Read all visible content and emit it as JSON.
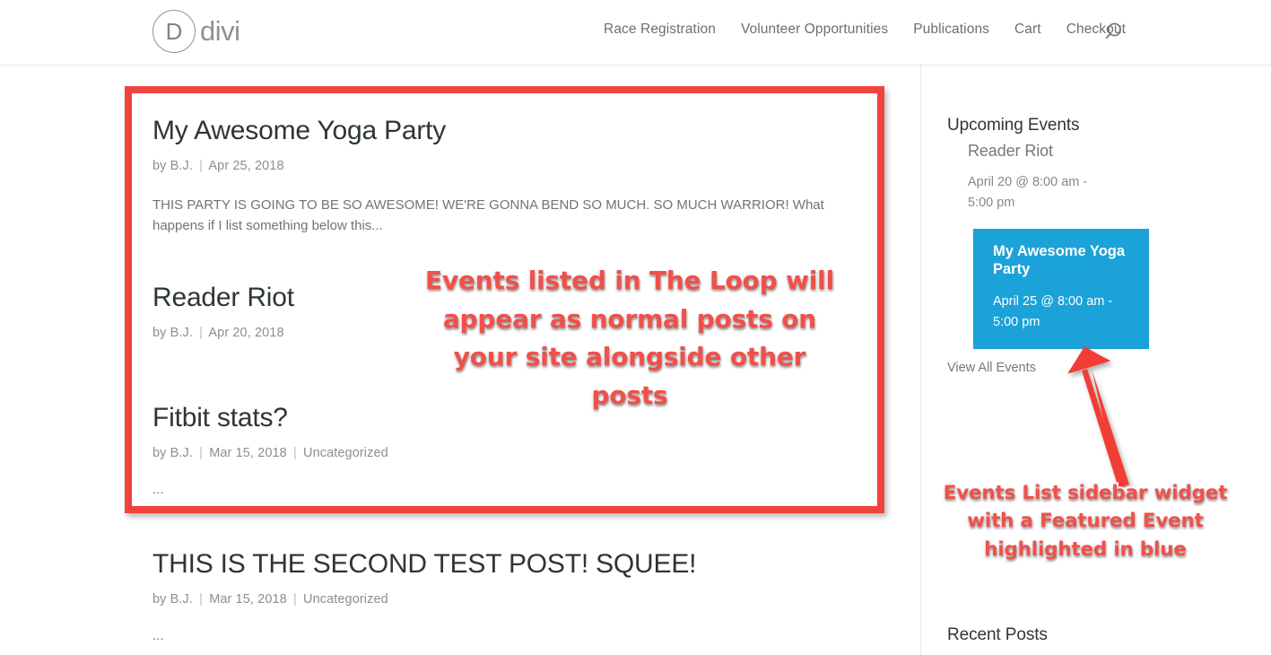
{
  "header": {
    "logo_letter": "D",
    "logo_text": "divi",
    "nav": [
      {
        "label": "Race Registration"
      },
      {
        "label": "Volunteer Opportunities"
      },
      {
        "label": "Publications"
      },
      {
        "label": "Cart"
      },
      {
        "label": "Checkout"
      }
    ],
    "search_icon": "search-icon"
  },
  "posts": [
    {
      "title": "My Awesome Yoga Party",
      "author": "by B.J.",
      "date": "Apr 25, 2018",
      "category": "",
      "excerpt": "THIS PARTY IS GOING TO BE SO AWESOME! WE'RE GONNA BEND SO MUCH. SO MUCH WARRIOR! What happens if I list something below this...",
      "ellipsis": ""
    },
    {
      "title": "Reader Riot",
      "author": "by B.J.",
      "date": "Apr 20, 2018",
      "category": "",
      "excerpt": "",
      "ellipsis": ""
    },
    {
      "title": "Fitbit stats?",
      "author": "by B.J.",
      "date": "Mar 15, 2018",
      "category": "Uncategorized",
      "excerpt": "",
      "ellipsis": "..."
    },
    {
      "title": "THIS IS THE SECOND TEST POST! SQUEE!",
      "author": "by B.J.",
      "date": "Mar 15, 2018",
      "category": "Uncategorized",
      "excerpt": "",
      "ellipsis": "..."
    }
  ],
  "sidebar": {
    "upcoming_events_title": "Upcoming Events",
    "events": [
      {
        "name": "Reader Riot",
        "date": "April 20 @ 8:00 am - 5:00 pm",
        "featured": false
      },
      {
        "name": "My Awesome Yoga Party",
        "date": "April 25 @ 8:00 am - 5:00 pm",
        "featured": true,
        "highlight_color": "#1ba2d9"
      }
    ],
    "view_all_label": "View All Events",
    "recent_posts_title": "Recent Posts"
  },
  "annotations": {
    "loop_note": "Events listed in The Loop will appear as normal posts on your site alongside other posts",
    "sidebar_note": "Events List sidebar widget with a Featured Event highlighted in blue",
    "accent_color": "#f1433d"
  },
  "separators": {
    "meta_sep": "|"
  }
}
